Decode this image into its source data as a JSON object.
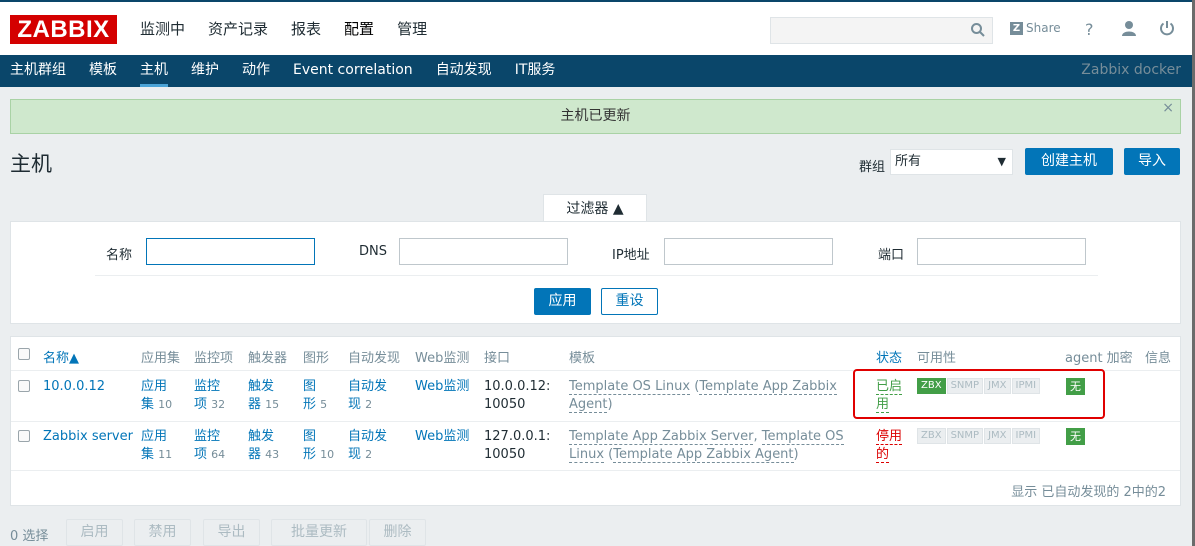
{
  "app": {
    "logo": "ZABBIX",
    "server_name": "Zabbix docker"
  },
  "main_nav": [
    "监测中",
    "资产记录",
    "报表",
    "配置",
    "管理"
  ],
  "main_nav_active": "配置",
  "header": {
    "share": "Share",
    "help": "?"
  },
  "sub_nav": [
    "主机群组",
    "模板",
    "主机",
    "维护",
    "动作",
    "Event correlation",
    "自动发现",
    "IT服务"
  ],
  "sub_nav_active": "主机",
  "message": "主机已更新",
  "page_title": "主机",
  "group_filter": {
    "label": "群组",
    "value": "所有"
  },
  "buttons": {
    "create_host": "创建主机",
    "import": "导入",
    "apply": "应用",
    "reset": "重设"
  },
  "filter": {
    "tab_label": "过滤器 ▲",
    "name_label": "名称",
    "dns_label": "DNS",
    "ip_label": "IP地址",
    "port_label": "端口"
  },
  "table": {
    "headers": {
      "name": "名称▲",
      "applications": "应用集",
      "items": "监控项",
      "triggers": "触发器",
      "graphs": "图形",
      "discovery": "自动发现",
      "web": "Web监测",
      "interface": "接口",
      "templates": "模板",
      "status": "状态",
      "availability": "可用性",
      "encryption": "agent 加密",
      "info": "信息"
    },
    "rows": [
      {
        "name": "10.0.0.12",
        "app_a": "应用",
        "app_b": "集",
        "app_count": "10",
        "items_a": "监控",
        "items_b": "项",
        "items_count": "32",
        "trig_a": "触发",
        "trig_b": "器",
        "trig_count": "15",
        "graph_a": "图",
        "graph_b": "形",
        "graph_count": "5",
        "disc_a": "自动发",
        "disc_b": "现",
        "disc_count": "2",
        "web": "Web监测",
        "iface_a": "10.0.0.12:",
        "iface_b": "10050",
        "tpl_1": "Template OS Linux",
        "tpl_2": "(",
        "tpl_3": "Template App Zabbix",
        "tpl_4": "Agent",
        "tpl_5": ")",
        "status_a": "已启",
        "status_b": "用",
        "avail": [
          "ZBX",
          "SNMP",
          "JMX",
          "IPMI"
        ],
        "encryption": "无"
      },
      {
        "name": "Zabbix server",
        "app_a": "应用",
        "app_b": "集",
        "app_count": "11",
        "items_a": "监控",
        "items_b": "项",
        "items_count": "64",
        "trig_a": "触发",
        "trig_b": "器",
        "trig_count": "43",
        "graph_a": "图",
        "graph_b": "形",
        "graph_count": "10",
        "disc_a": "自动发",
        "disc_b": "现",
        "disc_count": "2",
        "web": "Web监测",
        "iface_a": "127.0.0.1:",
        "iface_b": "10050",
        "tpl_1": "Template App Zabbix Server",
        "tpl_2": ",",
        "tpl_3": "Template OS",
        "tpl_4": "Linux",
        "tpl_5": "(",
        "tpl_6": "Template App Zabbix Agent",
        "tpl_7": ")",
        "status_a": "停用",
        "status_b": "的",
        "avail": [
          "ZBX",
          "SNMP",
          "JMX",
          "IPMI"
        ],
        "encryption": "无"
      }
    ],
    "footer": "显示 已自动发现的 2中的2"
  },
  "bottom": {
    "selected": "0 选择",
    "enable": "启用",
    "disable": "禁用",
    "export": "导出",
    "mass_update": "批量更新",
    "delete": "删除"
  },
  "colors": {
    "brand": "#d40000",
    "nav_bg": "#0a466a",
    "accent": "#0275b8",
    "success": "#429e47",
    "danger": "#dc0000"
  }
}
